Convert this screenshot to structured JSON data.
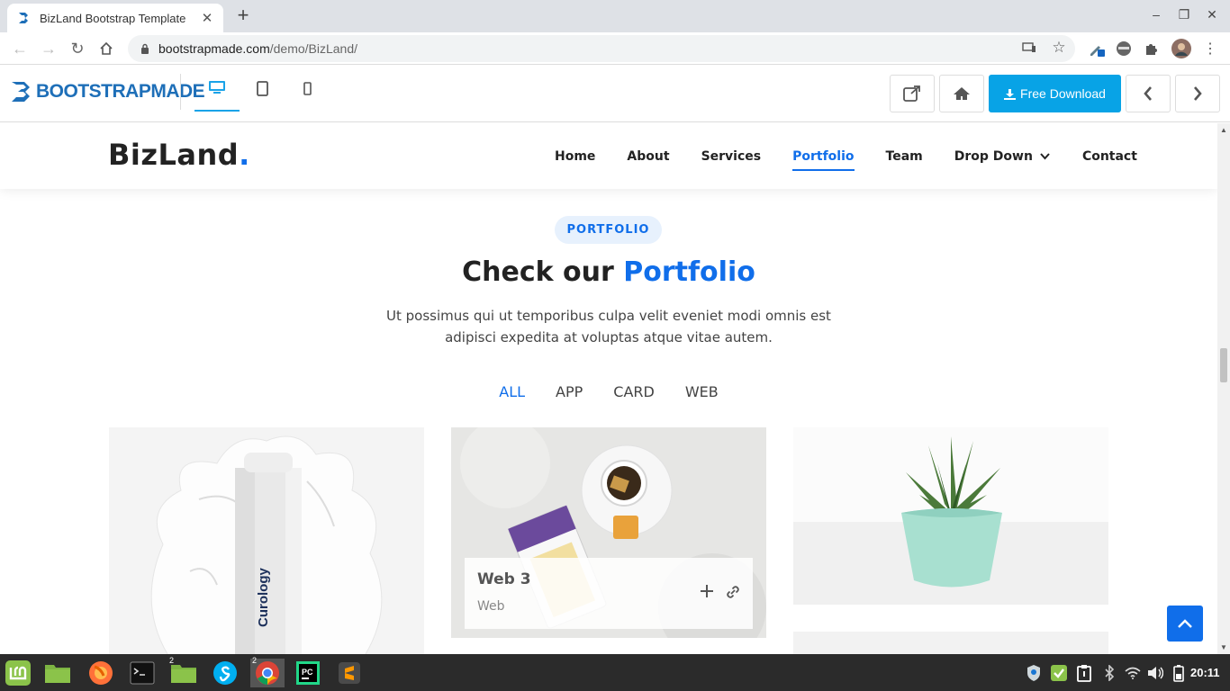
{
  "browser": {
    "tab_title": "BizLand Bootstrap Template",
    "url_host": "bootstrapmade.com",
    "url_path": "/demo/BizLand/"
  },
  "bm_bar": {
    "logo": "BOOTSTRAPMADE",
    "download_label": "Free Download"
  },
  "site": {
    "logo_text": "BizLand",
    "logo_dot": ".",
    "nav": [
      {
        "label": "Home"
      },
      {
        "label": "About"
      },
      {
        "label": "Services"
      },
      {
        "label": "Portfolio",
        "active": true
      },
      {
        "label": "Team"
      },
      {
        "label": "Drop Down"
      },
      {
        "label": "Contact"
      }
    ],
    "section_badge": "PORTFOLIO",
    "title_prefix": "Check our ",
    "title_highlight": "Portfolio",
    "description": "Ut possimus qui ut temporibus culpa velit eveniet modi omnis est adipisci expedita at voluptas atque vitae autem.",
    "filters": [
      "ALL",
      "APP",
      "CARD",
      "WEB"
    ],
    "active_filter": "ALL",
    "cards": [
      {
        "brand_text": "Curology"
      },
      {
        "title": "Web 3",
        "category": "Web"
      },
      {}
    ]
  },
  "taskbar": {
    "clock": "20:11",
    "badge_files": "2",
    "badge_chrome": "2"
  },
  "colors": {
    "accent": "#106eea",
    "download_button": "#08a3e6",
    "taskbar": "#2b2b2b"
  }
}
